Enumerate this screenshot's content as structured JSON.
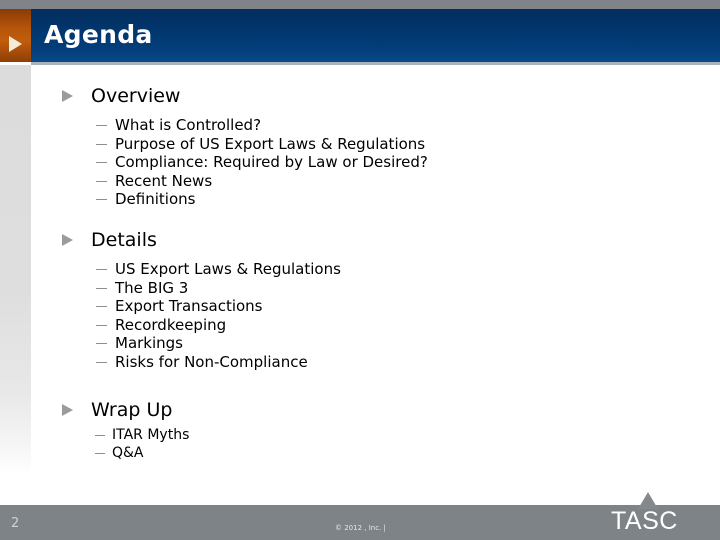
{
  "header": {
    "title": "Agenda",
    "arrow_icon": "play-triangle-icon",
    "accent_orange": "#b5540a",
    "band_navy": "#02376f"
  },
  "content": {
    "sections": [
      {
        "heading": "Overview",
        "items": [
          "What is Controlled?",
          "Purpose of US Export Laws & Regulations",
          "Compliance: Required by Law or Desired?",
          "Recent News",
          "Definitions"
        ]
      },
      {
        "heading": "Details",
        "items": [
          "US Export Laws & Regulations",
          "The BIG 3",
          "Export Transactions",
          "Recordkeeping",
          "Markings",
          "Risks for Non-Compliance"
        ]
      },
      {
        "heading": "Wrap Up",
        "items": [
          "ITAR Myths",
          "Q&A"
        ]
      }
    ]
  },
  "footer": {
    "page_number": "2",
    "copyright": "© 2012 , Inc. |",
    "logo_text": "TASC",
    "logo_mark": "triangle-mark-icon",
    "bar_color": "#7e8387"
  }
}
